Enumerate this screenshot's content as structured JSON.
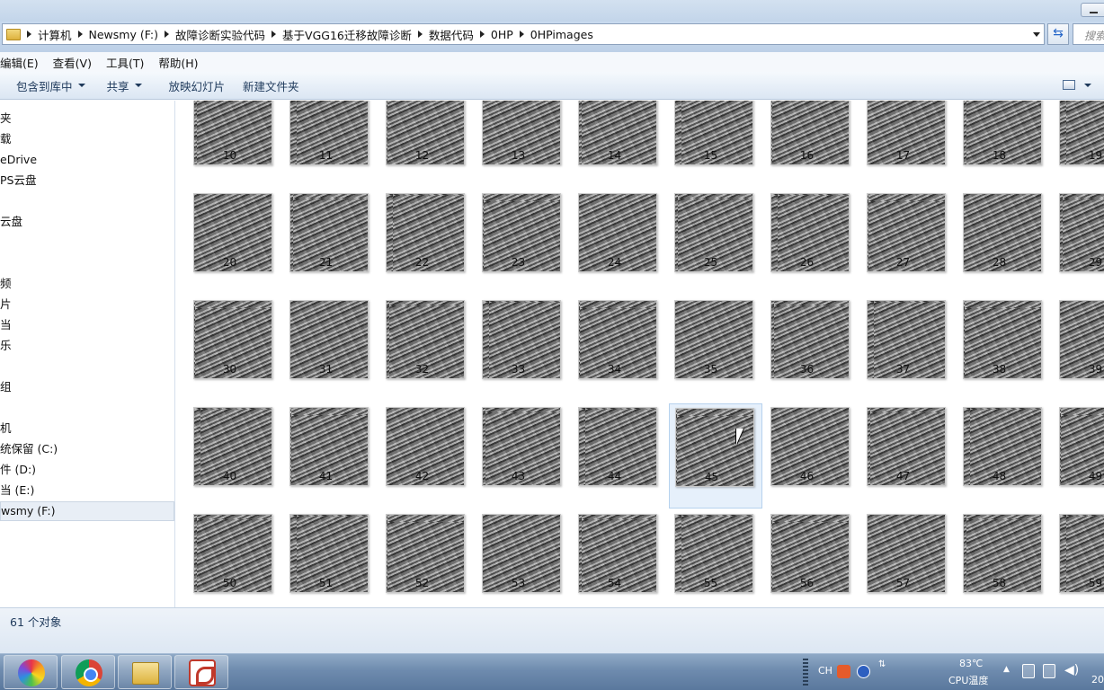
{
  "window": {
    "breadcrumbs": [
      "计算机",
      "Newsmy (F:)",
      "故障诊断实验代码",
      "基于VGG16迁移故障诊断",
      "数据代码",
      "0HP",
      "0HPimages"
    ],
    "search_placeholder": "搜索"
  },
  "menu": [
    "编辑(E)",
    "查看(V)",
    "工具(T)",
    "帮助(H)"
  ],
  "commands": {
    "include_library": "包含到库中",
    "share": "共享",
    "slideshow": "放映幻灯片",
    "new_folder": "新建文件夹"
  },
  "nav": [
    "夹",
    "载",
    "eDrive",
    "PS云盘",
    "云盘",
    "频",
    "片",
    "当",
    "乐",
    "组",
    "机",
    "统保留 (C:)",
    "件 (D:)",
    "当 (E:)",
    "wsmy (F:)"
  ],
  "nav_selected": "wsmy (F:)",
  "files": {
    "rows": [
      [
        "10",
        "11",
        "12",
        "13",
        "14",
        "15",
        "16",
        "17",
        "18",
        "19"
      ],
      [
        "20",
        "21",
        "22",
        "23",
        "24",
        "25",
        "26",
        "27",
        "28",
        "29"
      ],
      [
        "30",
        "31",
        "32",
        "33",
        "34",
        "35",
        "36",
        "37",
        "38",
        "39"
      ],
      [
        "40",
        "41",
        "42",
        "43",
        "44",
        "45",
        "46",
        "47",
        "48",
        "49"
      ],
      [
        "50",
        "51",
        "52",
        "53",
        "54",
        "55",
        "56",
        "57",
        "58",
        "59"
      ]
    ],
    "selected": "45"
  },
  "status": {
    "count": "61 个对象"
  },
  "taskbar": {
    "apps": [
      "spinner-app-icon",
      "chrome-icon",
      "explorer-icon",
      "wps-icon"
    ],
    "tray": {
      "lang": "CH",
      "temp": "83℃",
      "temp_label": "CPU温度",
      "clock": "20"
    }
  },
  "colors": {
    "accent": "#1e395b",
    "selection": "#e6f0fb"
  }
}
